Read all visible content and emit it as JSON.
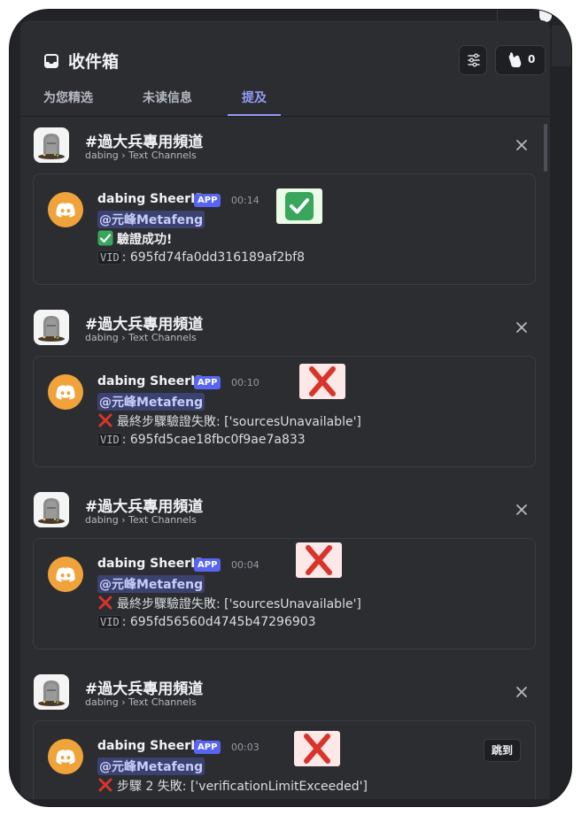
{
  "inbox": {
    "title": "收件箱",
    "mention_count": "0"
  },
  "tabs": [
    {
      "label": "为您精选",
      "active": false
    },
    {
      "label": "未读信息",
      "active": false
    },
    {
      "label": "提及",
      "active": true
    }
  ],
  "notifications": [
    {
      "channel": "#過大兵專用頻道",
      "path": "dabing › Text Channels",
      "author": "dabing SheerID",
      "badge": "APP",
      "time": "00:14",
      "status_icon": "check-mark-emoji",
      "mention": "@元峰Metafeng",
      "line3_icon": "check-mark-emoji",
      "line3": "驗證成功!",
      "vid_label": "VID",
      "vid_value": ": 695fd74fa0dd316189af2bf8"
    },
    {
      "channel": "#過大兵專用頻道",
      "path": "dabing › Text Channels",
      "author": "dabing SheerID",
      "badge": "APP",
      "time": "00:10",
      "status_icon": "cross-mark-emoji",
      "mention": "@元峰Metafeng",
      "line3_icon": "cross-mark-emoji",
      "line3": "最終步驟驗證失敗: ['sourcesUnavailable']",
      "vid_label": "VID",
      "vid_value": ": 695fd5cae18fbc0f9ae7a833"
    },
    {
      "channel": "#過大兵專用頻道",
      "path": "dabing › Text Channels",
      "author": "dabing SheerID",
      "badge": "APP",
      "time": "00:04",
      "status_icon": "cross-mark-emoji",
      "mention": "@元峰Metafeng",
      "line3_icon": "cross-mark-emoji",
      "line3": "最終步驟驗證失敗: ['sourcesUnavailable']",
      "vid_label": "VID",
      "vid_value": ": 695fd56560d4745b47296903"
    },
    {
      "channel": "#過大兵專用頻道",
      "path": "dabing › Text Channels",
      "author": "dabing SheerID",
      "badge": "APP",
      "time": "00:03",
      "status_icon": "cross-mark-emoji",
      "mention": "@元峰Metafeng",
      "line3_icon": "cross-mark-emoji",
      "line3": "步驟 2 失敗: ['verificationLimitExceeded']",
      "jump_label": "跳到"
    }
  ],
  "colors": {
    "accent": "#949cf7",
    "bot_avatar": "#f0a33a",
    "badge": "#5865f2",
    "success": "#3aa55d",
    "error": "#d9342b"
  }
}
